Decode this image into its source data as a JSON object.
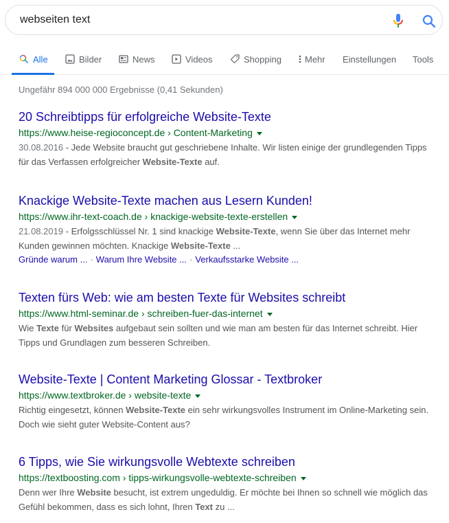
{
  "search": {
    "query": "webseiten text",
    "voice_label": "mic-icon",
    "search_label": "search-icon"
  },
  "tabs": [
    {
      "label": "Alle",
      "icon": "search-icon",
      "active": true
    },
    {
      "label": "Bilder",
      "icon": "image-icon"
    },
    {
      "label": "News",
      "icon": "news-icon"
    },
    {
      "label": "Videos",
      "icon": "play-icon"
    },
    {
      "label": "Shopping",
      "icon": "tag-icon"
    },
    {
      "label": "Mehr",
      "icon": "more-vertical-icon"
    },
    {
      "label": "Einstellungen"
    },
    {
      "label": "Tools"
    }
  ],
  "stats": "Ungefähr 894 000 000 Ergebnisse (0,41 Sekunden)",
  "colors": {
    "link": "#1a0dab",
    "url": "#006621",
    "accent": "#1a73e8",
    "snippet": "#545454"
  },
  "results": [
    {
      "title": "20 Schreibtipps für erfolgreiche Website-Texte",
      "url_domain": "https://www.heise-regioconcept.de",
      "url_path": "Content-Marketing",
      "date": "30.08.2016",
      "snippet": [
        {
          "t": "Jede Website braucht gut geschriebene Inhalte. Wir listen einige der grundlegenden Tipps für das Verfassen erfolgreicher "
        },
        {
          "t": "Website-Texte",
          "b": true
        },
        {
          "t": " auf."
        }
      ]
    },
    {
      "title": "Knackige Website-Texte machen aus Lesern Kunden!",
      "url_domain": "https://www.ihr-text-coach.de",
      "url_path": "knackige-website-texte-erstellen",
      "date": "21.08.2019",
      "snippet": [
        {
          "t": "Erfolgsschlüssel Nr. 1 sind knackige "
        },
        {
          "t": "Website-Texte",
          "b": true
        },
        {
          "t": ", wenn Sie über das Internet mehr Kunden gewinnen möchten. Knackige "
        },
        {
          "t": "Website-Texte",
          "b": true
        },
        {
          "t": " ..."
        }
      ],
      "sitelinks": [
        "Gründe warum ...",
        "Warum Ihre Website ...",
        "Verkaufsstarke Website ..."
      ]
    },
    {
      "title": "Texten fürs Web: wie am besten Texte für Websites schreibt",
      "url_domain": "https://www.html-seminar.de",
      "url_path": "schreiben-fuer-das-internet",
      "snippet": [
        {
          "t": "Wie "
        },
        {
          "t": "Texte",
          "b": true
        },
        {
          "t": " für "
        },
        {
          "t": "Websites",
          "b": true
        },
        {
          "t": " aufgebaut sein sollten und wie man am besten für das Internet schreibt. Hier Tipps und Grundlagen zum besseren Schreiben."
        }
      ]
    },
    {
      "title": "Website-Texte | Content Marketing Glossar - Textbroker",
      "url_domain": "https://www.textbroker.de",
      "url_path": "website-texte",
      "snippet": [
        {
          "t": "Richtig eingesetzt, können "
        },
        {
          "t": "Website-Texte",
          "b": true
        },
        {
          "t": " ein sehr wirkungsvolles Instrument im Online-Marketing sein. Doch wie sieht guter Website-Content aus?"
        }
      ]
    },
    {
      "title": "6 Tipps, wie Sie wirkungsvolle Webtexte schreiben",
      "url_domain": "https://textboosting.com",
      "url_path": "tipps-wirkungsvolle-webtexte-schreiben",
      "snippet": [
        {
          "t": "Denn wer Ihre "
        },
        {
          "t": "Website",
          "b": true
        },
        {
          "t": " besucht, ist extrem ungeduldig. Er möchte bei Ihnen so schnell wie möglich das Gefühl bekommen, dass es sich lohnt, Ihren "
        },
        {
          "t": "Text",
          "b": true
        },
        {
          "t": " zu ..."
        }
      ]
    }
  ]
}
